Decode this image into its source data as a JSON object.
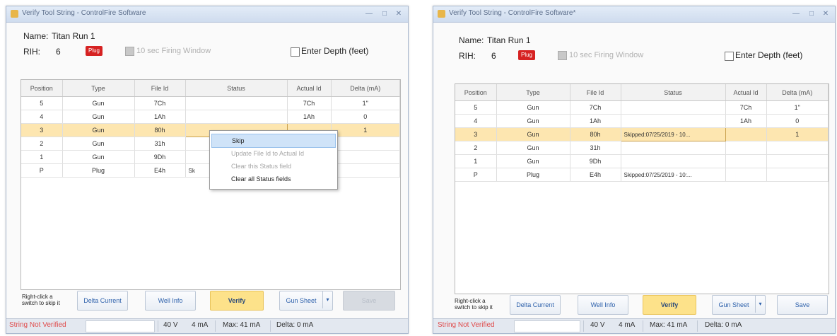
{
  "colors": {
    "selected_row": "#fde6b0",
    "verify_button": "#fde28a",
    "plug_badge": "#d62222",
    "not_verified_text": "#e04b4b",
    "menu_highlight": "#cfe3f8"
  },
  "columns": [
    "Position",
    "Type",
    "File Id",
    "Status",
    "Actual Id",
    "Delta (mA)"
  ],
  "left": {
    "title": "Verify Tool String - ControlFire Software",
    "name_label": "Name:",
    "name_value": "Titan Run 1",
    "rih_label": "RIH:",
    "rih_value": "6",
    "plug_badge": "Plug",
    "firing_window_label": "10 sec Firing Window",
    "enter_depth_label": "Enter Depth (feet)",
    "rows": [
      {
        "position": "5",
        "type": "Gun",
        "file_id": "7Ch",
        "status": "",
        "actual_id": "7Ch",
        "delta": "1\"",
        "selected": false
      },
      {
        "position": "4",
        "type": "Gun",
        "file_id": "1Ah",
        "status": "",
        "actual_id": "1Ah",
        "delta": "0",
        "selected": false
      },
      {
        "position": "3",
        "type": "Gun",
        "file_id": "80h",
        "status": "",
        "actual_id": "",
        "delta": "1",
        "selected": true
      },
      {
        "position": "2",
        "type": "Gun",
        "file_id": "31h",
        "status": "",
        "actual_id": "",
        "delta": "",
        "selected": false
      },
      {
        "position": "1",
        "type": "Gun",
        "file_id": "9Dh",
        "status": "",
        "actual_id": "",
        "delta": "",
        "selected": false
      },
      {
        "position": "P",
        "type": "Plug",
        "file_id": "E4h",
        "status": "Sk",
        "actual_id": "",
        "delta": "",
        "selected": false
      }
    ],
    "context_menu": [
      {
        "label": "Skip",
        "state": "highlighted"
      },
      {
        "label": "Update File Id to Actual Id",
        "state": "disabled"
      },
      {
        "label": "Clear this Status field",
        "state": "disabled"
      },
      {
        "label": "Clear all Status fields",
        "state": "normal"
      }
    ],
    "hint": "Right-click a switch to skip it",
    "buttons": {
      "delta_current": "Delta Current",
      "well_info": "Well Info",
      "verify": "Verify",
      "gun_sheet": "Gun Sheet",
      "save": "Save"
    },
    "status": {
      "verified": "String Not Verified",
      "voltage": "40 V",
      "current": "4 mA",
      "max": "Max: 41 mA",
      "delta": "Delta: 0 mA"
    }
  },
  "right": {
    "title": "Verify Tool String - ControlFire Software*",
    "name_label": "Name:",
    "name_value": "Titan Run 1",
    "rih_label": "RIH:",
    "rih_value": "6",
    "plug_badge": "Plug",
    "firing_window_label": "10 sec Firing Window",
    "enter_depth_label": "Enter Depth (feet)",
    "rows": [
      {
        "position": "5",
        "type": "Gun",
        "file_id": "7Ch",
        "status": "",
        "actual_id": "7Ch",
        "delta": "1\"",
        "selected": false
      },
      {
        "position": "4",
        "type": "Gun",
        "file_id": "1Ah",
        "status": "",
        "actual_id": "1Ah",
        "delta": "0",
        "selected": false
      },
      {
        "position": "3",
        "type": "Gun",
        "file_id": "80h",
        "status": "Skipped:07/25/2019 - 10...",
        "actual_id": "",
        "delta": "1",
        "selected": true
      },
      {
        "position": "2",
        "type": "Gun",
        "file_id": "31h",
        "status": "",
        "actual_id": "",
        "delta": "",
        "selected": false
      },
      {
        "position": "1",
        "type": "Gun",
        "file_id": "9Dh",
        "status": "",
        "actual_id": "",
        "delta": "",
        "selected": false
      },
      {
        "position": "P",
        "type": "Plug",
        "file_id": "E4h",
        "status": "Skipped:07/25/2019 - 10:...",
        "actual_id": "",
        "delta": "",
        "selected": false
      }
    ],
    "hint": "Right-click a switch to skip it",
    "buttons": {
      "delta_current": "Delta Current",
      "well_info": "Well Info",
      "verify": "Verify",
      "gun_sheet": "Gun Sheet",
      "save": "Save"
    },
    "status": {
      "verified": "String Not Verified",
      "voltage": "40 V",
      "current": "4 mA",
      "max": "Max: 41 mA",
      "delta": "Delta: 0 mA"
    }
  }
}
